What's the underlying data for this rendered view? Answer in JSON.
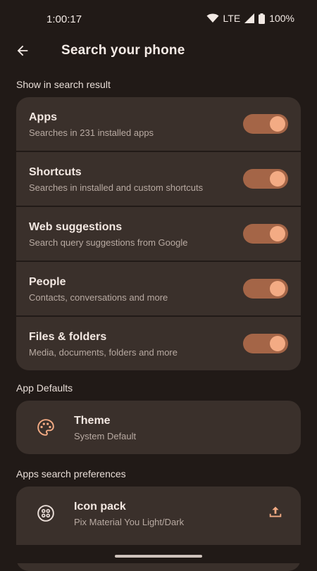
{
  "status": {
    "time": "1:00:17",
    "network": "LTE",
    "battery": "100%"
  },
  "app_bar": {
    "title": "Search your phone",
    "back_icon": "arrow-back-icon"
  },
  "sections": {
    "show_in_search": {
      "title": "Show in search result",
      "items": [
        {
          "title": "Apps",
          "subtitle": "Searches in 231 installed apps",
          "enabled": true
        },
        {
          "title": "Shortcuts",
          "subtitle": "Searches in installed and custom shortcuts",
          "enabled": true
        },
        {
          "title": "Web suggestions",
          "subtitle": "Search query suggestions from Google",
          "enabled": true
        },
        {
          "title": "People",
          "subtitle": "Contacts, conversations and more",
          "enabled": true
        },
        {
          "title": "Files & folders",
          "subtitle": "Media, documents, folders and more",
          "enabled": true
        }
      ]
    },
    "app_defaults": {
      "title": "App Defaults",
      "theme": {
        "title": "Theme",
        "subtitle": "System Default",
        "icon": "palette-icon"
      }
    },
    "apps_search_prefs": {
      "title": "Apps search preferences",
      "icon_pack": {
        "title": "Icon pack",
        "subtitle": "Pix Material You Light/Dark",
        "icon": "icon-pack-icon",
        "action_icon": "upload-icon"
      }
    }
  },
  "colors": {
    "background": "#211a17",
    "card": "#3a302b",
    "accent": "#f3ab84",
    "toggle_track": "#a46547"
  }
}
